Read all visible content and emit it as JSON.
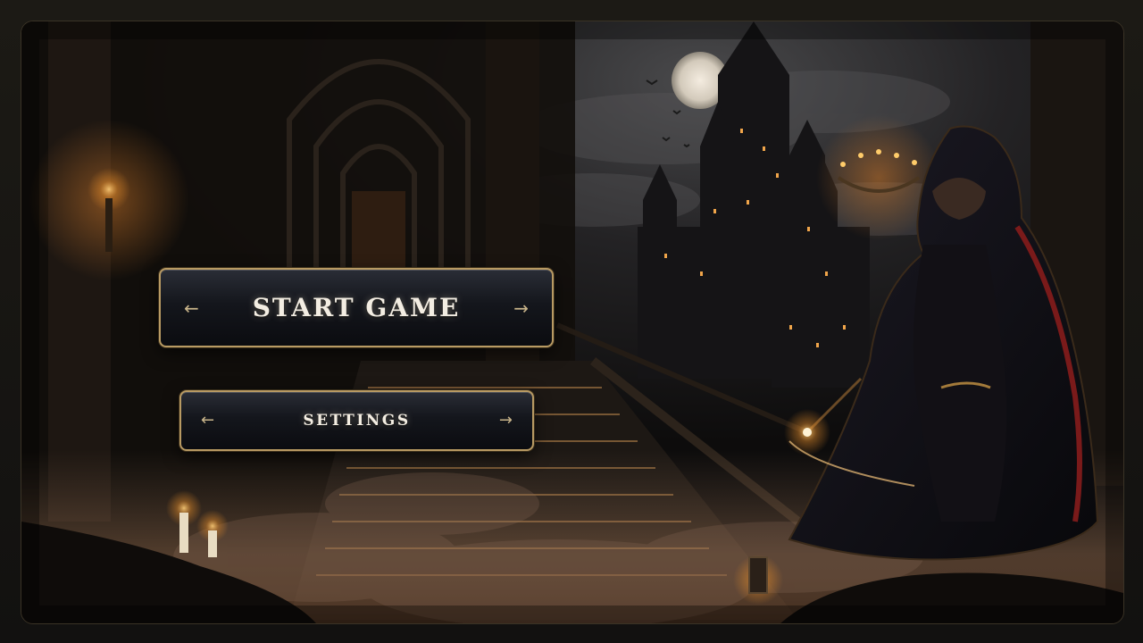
{
  "menu": {
    "start_label": "START GAME",
    "settings_label": "SETTINGS"
  },
  "icons": {
    "left_arrow": "←",
    "right_arrow": "→"
  },
  "colors": {
    "button_border": "#b89a63",
    "button_text": "#f3ede2",
    "arrow": "#c8b48a"
  }
}
